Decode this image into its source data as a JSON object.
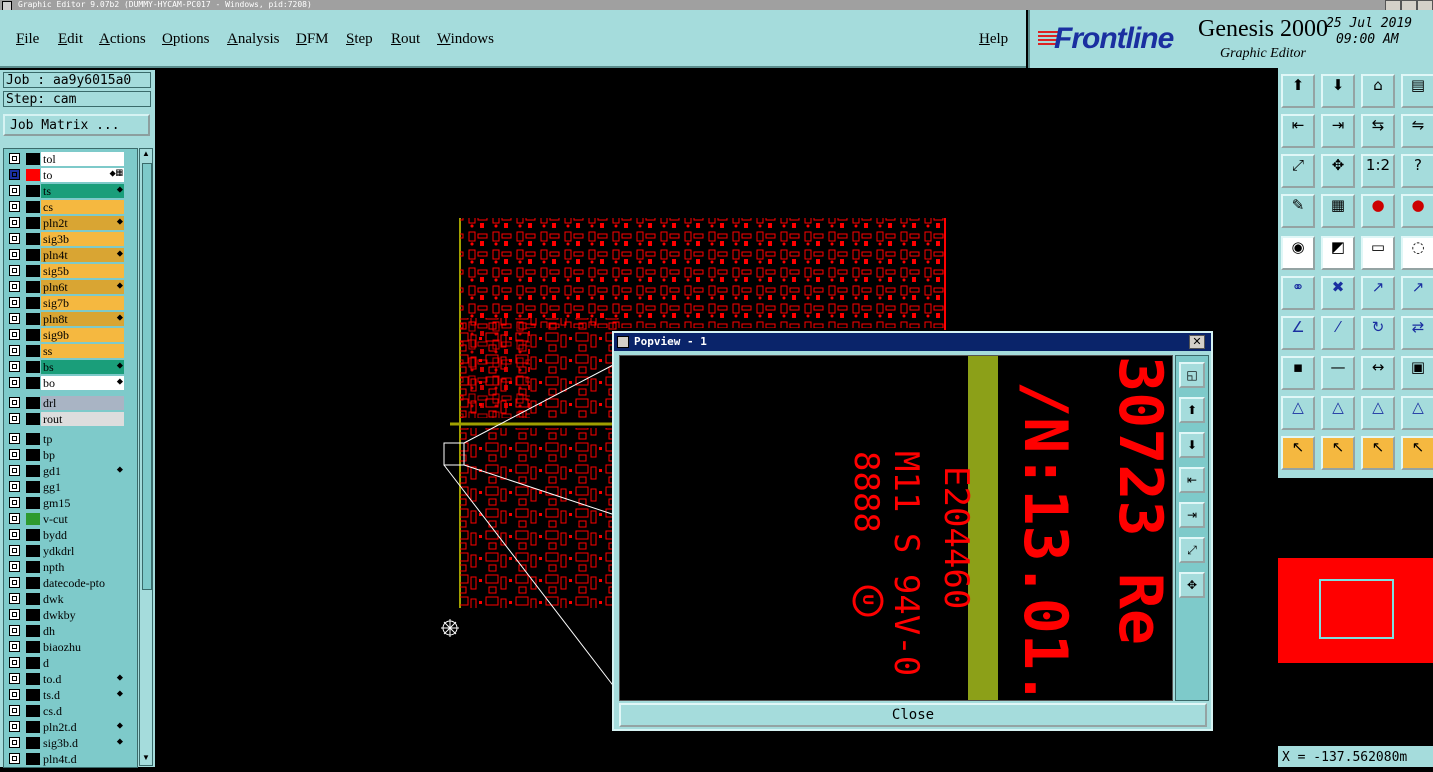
{
  "window": {
    "title": "Graphic Editor 9.07b2 (DUMMY-HYCAM-PC017 - Windows, pid:7208)"
  },
  "menu": {
    "items": [
      "File",
      "Edit",
      "Actions",
      "Options",
      "Analysis",
      "DFM",
      "Step",
      "Rout",
      "Windows"
    ],
    "help": "Help"
  },
  "branding": {
    "logo": "Frontline",
    "product": "Genesis 2000",
    "subtitle": "Graphic Editor",
    "date": "25 Jul 2019",
    "time": "09:00 AM",
    "logo_color": "#1a2fa0",
    "logo_accent_color": "#dd2222"
  },
  "job": {
    "job_label": "Job : aa9y6015a0",
    "step_label": "Step: cam",
    "matrix_button": "Job Matrix ..."
  },
  "layers": [
    {
      "name": "tol",
      "bg": "#ffffff",
      "color": "#000000",
      "flag": ""
    },
    {
      "name": "to",
      "bg": "#ffffff",
      "color": "#ff0000",
      "flag": "⬥▦",
      "active": true
    },
    {
      "name": "ts",
      "bg": "#1a9e7a",
      "color": "#000000",
      "flag": "⬥"
    },
    {
      "name": "cs",
      "bg": "#f5b840",
      "color": "#000000",
      "flag": ""
    },
    {
      "name": "pln2t",
      "bg": "#d9a533",
      "color": "#000000",
      "flag": "⬥"
    },
    {
      "name": "sig3b",
      "bg": "#f5b840",
      "color": "#000000",
      "flag": ""
    },
    {
      "name": "pln4t",
      "bg": "#d9a533",
      "color": "#000000",
      "flag": "⬥"
    },
    {
      "name": "sig5b",
      "bg": "#f5b840",
      "color": "#000000",
      "flag": ""
    },
    {
      "name": "pln6t",
      "bg": "#d9a533",
      "color": "#000000",
      "flag": "⬥"
    },
    {
      "name": "sig7b",
      "bg": "#f5b840",
      "color": "#000000",
      "flag": ""
    },
    {
      "name": "pln8t",
      "bg": "#d9a533",
      "color": "#000000",
      "flag": "⬥"
    },
    {
      "name": "sig9b",
      "bg": "#f5b840",
      "color": "#000000",
      "flag": ""
    },
    {
      "name": "ss",
      "bg": "#f5b840",
      "color": "#000000",
      "flag": ""
    },
    {
      "name": "bs",
      "bg": "#1a9e7a",
      "color": "#000000",
      "flag": "⬥"
    },
    {
      "name": "bo",
      "bg": "#ffffff",
      "color": "#000000",
      "flag": "⬥"
    },
    {
      "name": "drl",
      "bg": "#a9b4c4",
      "color": "#000000",
      "flag": "",
      "gap": true
    },
    {
      "name": "rout",
      "bg": "#dddddd",
      "color": "#000000",
      "flag": ""
    },
    {
      "name": "tp",
      "bg": "#7ecaca",
      "color": "#000000",
      "flag": "",
      "gap": true
    },
    {
      "name": "bp",
      "bg": "#7ecaca",
      "color": "#000000",
      "flag": ""
    },
    {
      "name": "gd1",
      "bg": "#7ecaca",
      "color": "#000000",
      "flag": "⬥"
    },
    {
      "name": "gg1",
      "bg": "#7ecaca",
      "color": "#000000",
      "flag": ""
    },
    {
      "name": "gm15",
      "bg": "#7ecaca",
      "color": "#000000",
      "flag": ""
    },
    {
      "name": "v-cut",
      "bg": "#7ecaca",
      "color": "#2e9a2e",
      "flag": ""
    },
    {
      "name": "bydd",
      "bg": "#7ecaca",
      "color": "#000000",
      "flag": ""
    },
    {
      "name": "ydkdrl",
      "bg": "#7ecaca",
      "color": "#000000",
      "flag": ""
    },
    {
      "name": "npth",
      "bg": "#7ecaca",
      "color": "#000000",
      "flag": ""
    },
    {
      "name": "datecode-pto",
      "bg": "#7ecaca",
      "color": "#000000",
      "flag": ""
    },
    {
      "name": "dwk",
      "bg": "#7ecaca",
      "color": "#000000",
      "flag": ""
    },
    {
      "name": "dwkby",
      "bg": "#7ecaca",
      "color": "#000000",
      "flag": ""
    },
    {
      "name": "dh",
      "bg": "#7ecaca",
      "color": "#000000",
      "flag": ""
    },
    {
      "name": "biaozhu",
      "bg": "#7ecaca",
      "color": "#000000",
      "flag": ""
    },
    {
      "name": "d",
      "bg": "#7ecaca",
      "color": "#000000",
      "flag": ""
    },
    {
      "name": "to.d",
      "bg": "#7ecaca",
      "color": "#000000",
      "flag": "⬥"
    },
    {
      "name": "ts.d",
      "bg": "#7ecaca",
      "color": "#000000",
      "flag": "⬥"
    },
    {
      "name": "cs.d",
      "bg": "#7ecaca",
      "color": "#000000",
      "flag": ""
    },
    {
      "name": "pln2t.d",
      "bg": "#7ecaca",
      "color": "#000000",
      "flag": "⬥"
    },
    {
      "name": "sig3b.d",
      "bg": "#7ecaca",
      "color": "#000000",
      "flag": "⬥"
    },
    {
      "name": "pln4t.d",
      "bg": "#7ecaca",
      "color": "#000000",
      "flag": ""
    }
  ],
  "toolbar": [
    [
      "⬆",
      "⬇",
      "⌂",
      "▤"
    ],
    [
      "⇤",
      "⇥",
      "⇆",
      "⇋"
    ],
    [
      "⤢",
      "✥",
      "1:2",
      "?"
    ],
    [
      "✎",
      "▦",
      "●",
      "●"
    ],
    [
      "◉",
      "◩",
      "▭",
      "◌"
    ],
    [
      "⚭",
      "✖",
      "↗",
      "↗"
    ],
    [
      "∠",
      "⁄",
      "↻",
      "⇄"
    ],
    [
      "▪",
      "—",
      "↔",
      "▣"
    ],
    [
      "△",
      "△",
      "△",
      "△"
    ],
    [
      "↖",
      "↖",
      "↖",
      "↖"
    ]
  ],
  "toolbar_styles": [
    [
      "",
      "",
      "",
      ""
    ],
    [
      "",
      "",
      "",
      ""
    ],
    [
      "",
      "",
      "",
      ""
    ],
    [
      "",
      "",
      "",
      ""
    ],
    [
      "white",
      "white",
      "white",
      "white"
    ],
    [
      "",
      "",
      "",
      ""
    ],
    [
      "",
      "",
      "",
      ""
    ],
    [
      "",
      "",
      "",
      ""
    ],
    [
      "",
      "",
      "",
      ""
    ],
    [
      "orange",
      "orange",
      "orange",
      "orange"
    ]
  ],
  "toolbar_names": [
    [
      "zoom-home-icon",
      "zoom-down-icon",
      "home-icon",
      "grid-icon"
    ],
    [
      "pan-left-icon",
      "pan-right-icon",
      "swap-icon",
      "flip-icon"
    ],
    [
      "fit-icon",
      "center-icon",
      "ratio-icon",
      "help-icon"
    ],
    [
      "measure-icon",
      "snap-grid-icon",
      "select-red-icon",
      "select-blue-icon"
    ],
    [
      "pad-icon",
      "feature-icon",
      "ruler-icon",
      "circle-icon"
    ],
    [
      "connect-icon",
      "delete-icon",
      "move-icon",
      "copy-icon"
    ],
    [
      "angle-icon",
      "line-icon",
      "rotate-icon",
      "mirror-icon"
    ],
    [
      "add-pad-icon",
      "add-line-icon",
      "resize-icon",
      "cluster-icon"
    ],
    [
      "triangle-icon",
      "triangle-up-icon",
      "triangle-red-icon",
      "triangle-fill-icon"
    ],
    [
      "pointer-icon",
      "pointer-select-icon",
      "pointer-area-icon",
      "pointer-route-icon"
    ]
  ],
  "coords": {
    "x_readout": "X = -137.562080m"
  },
  "popview": {
    "title": "Popview - 1",
    "close_label": "Close",
    "close_x": "✕",
    "texts": {
      "ul": "E204460",
      "material": "M11 S 94V-0",
      "datecode": "8888",
      "part_a": "/N:13.01.",
      "part_b": "30723 Re"
    },
    "tools": [
      "◱",
      "⬆",
      "⬇",
      "⇤",
      "⇥",
      "⤢",
      "✥"
    ],
    "tool_names": [
      "zoom-window-icon",
      "zoom-in-icon",
      "zoom-out-icon",
      "pan-left-icon",
      "pan-right-icon",
      "fit-icon",
      "center-icon"
    ],
    "artwork_color": "#ff0000",
    "strip_color": "#8ca018"
  },
  "canvas": {
    "artwork_color": "#ff0000",
    "outline_color": "#a0a000"
  }
}
